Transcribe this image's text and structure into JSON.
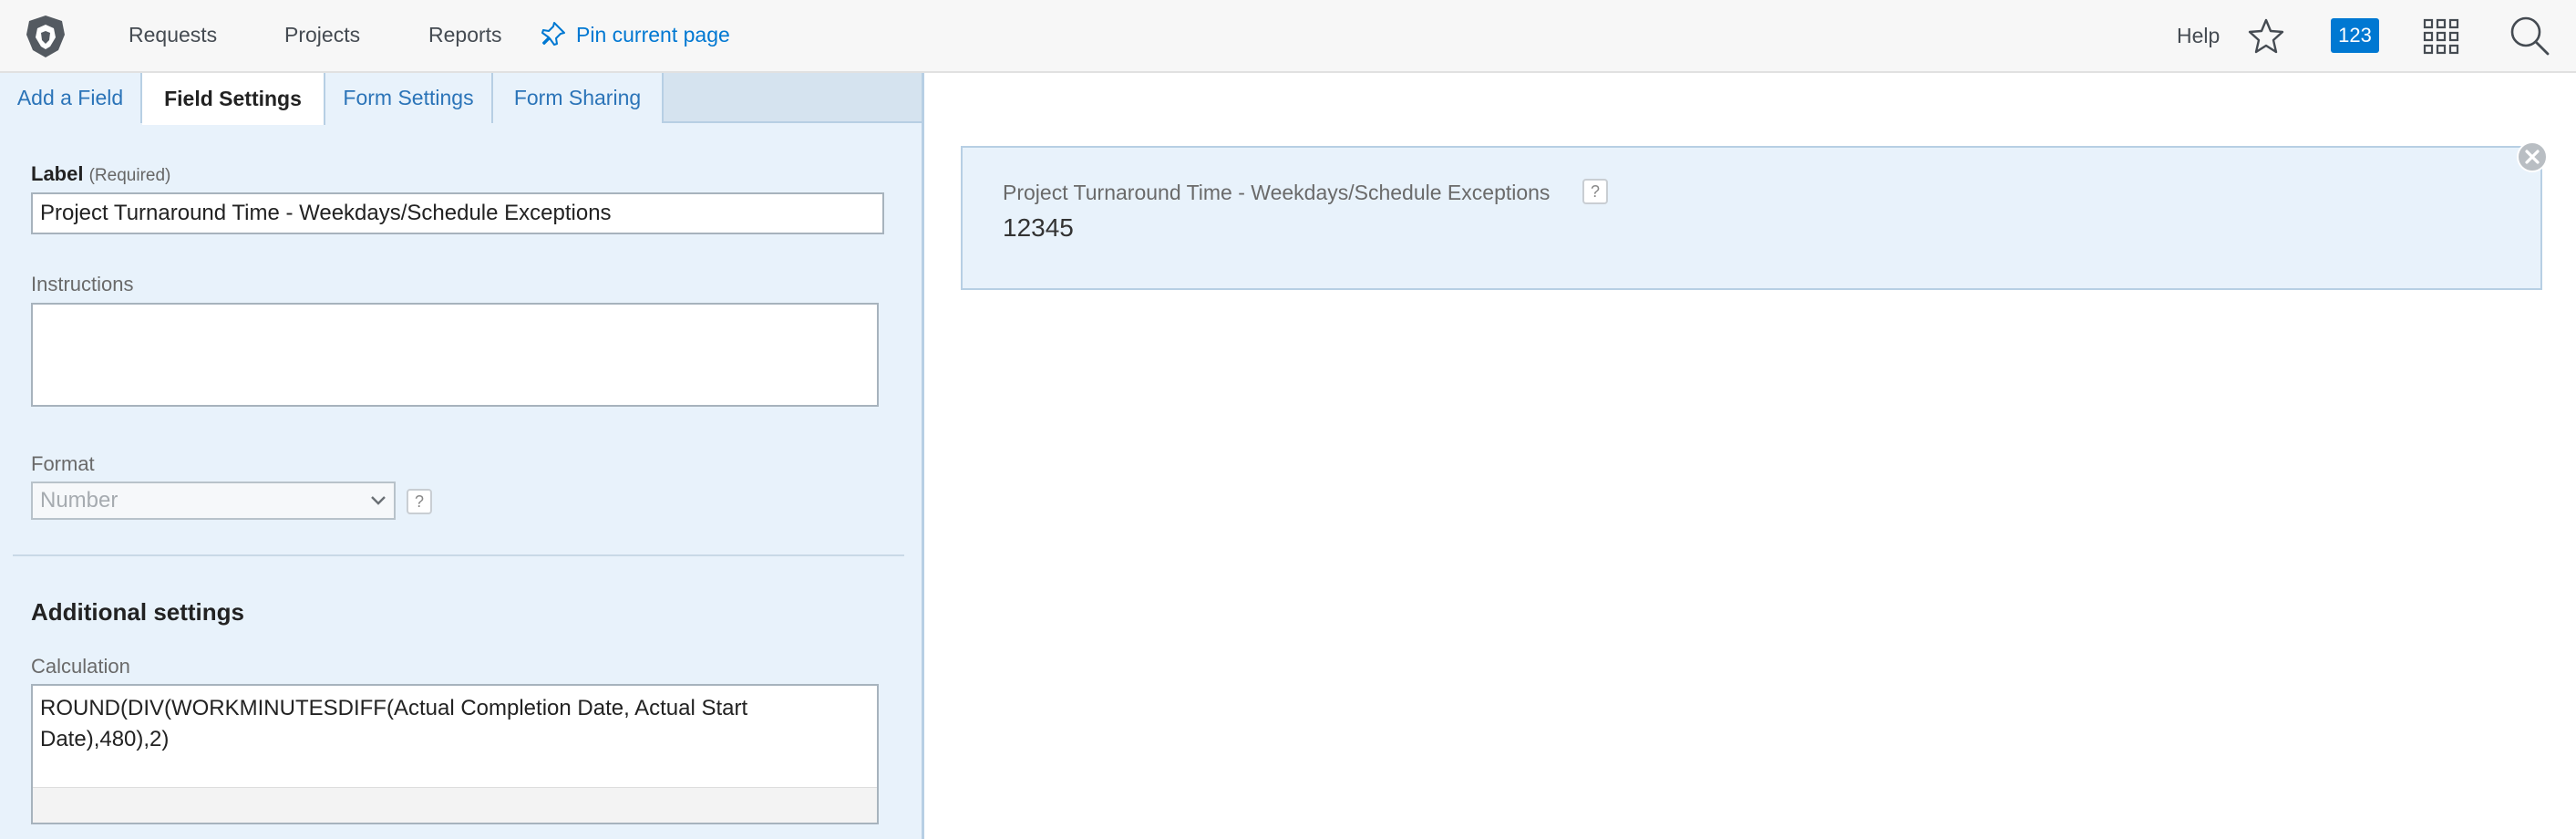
{
  "nav": {
    "links": [
      "Requests",
      "Projects",
      "Reports"
    ],
    "pin_label": "Pin current page",
    "help_label": "Help",
    "badge_count": "123"
  },
  "tabs": [
    {
      "label": "Add a Field",
      "active": false
    },
    {
      "label": "Field Settings",
      "active": true
    },
    {
      "label": "Form Settings",
      "active": false
    },
    {
      "label": "Form Sharing",
      "active": false
    }
  ],
  "field_settings": {
    "label_title": "Label",
    "label_required": "(Required)",
    "label_value": "Project Turnaround Time - Weekdays/Schedule Exceptions",
    "instructions_title": "Instructions",
    "instructions_value": "",
    "format_title": "Format",
    "format_value": "Number",
    "help_glyph": "?",
    "additional_title": "Additional settings",
    "calculation_title": "Calculation",
    "calculation_value": "ROUND(DIV(WORKMINUTESDIFF(Actual Completion Date, Actual Start Date),480),2)"
  },
  "preview": {
    "label": "Project Turnaround Time - Weekdays/Schedule Exceptions",
    "value": "12345",
    "help_glyph": "?"
  },
  "colors": {
    "accent": "#0078d2",
    "panel_bg": "#e8f2fb",
    "panel_border": "#b7cfe4"
  }
}
